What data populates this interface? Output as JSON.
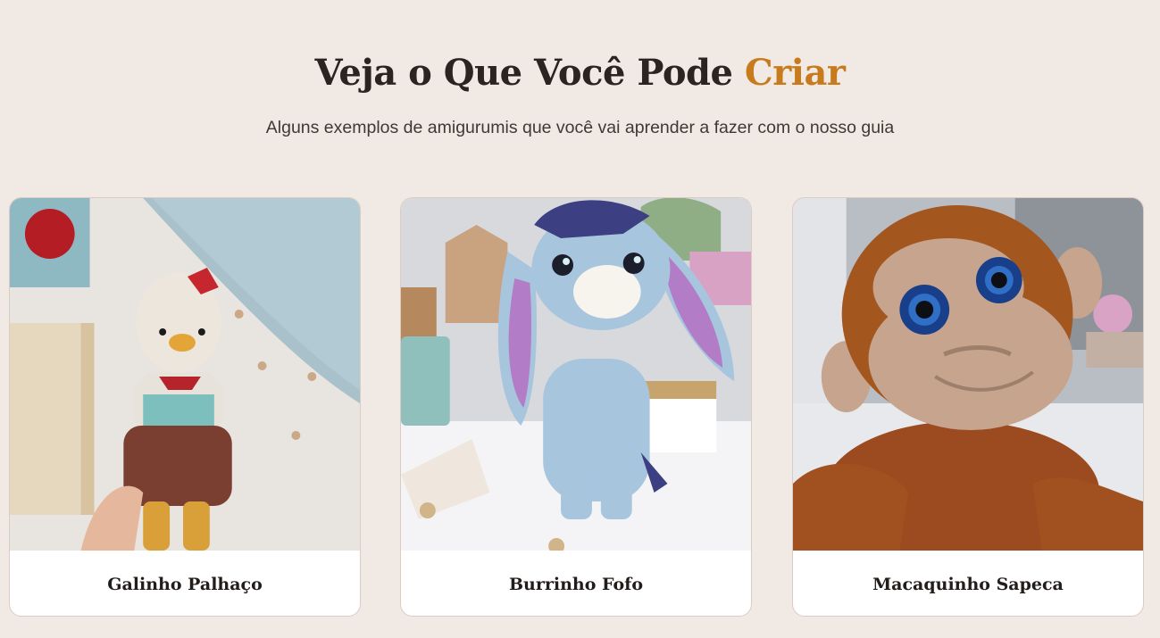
{
  "section": {
    "title_main": "Veja o Que Você Pode ",
    "title_accent": "Criar",
    "subtitle": "Alguns exemplos de amigurumis que você vai aprender a fazer com o nosso guia"
  },
  "cards": [
    {
      "title": "Galinho Palhaço"
    },
    {
      "title": "Burrinho Fofo"
    },
    {
      "title": "Macaquinho Sapeca"
    }
  ],
  "colors": {
    "background": "#f1e9e4",
    "accent": "#c87b1c",
    "heading": "#2b2522",
    "card_border": "#dccbc3"
  }
}
